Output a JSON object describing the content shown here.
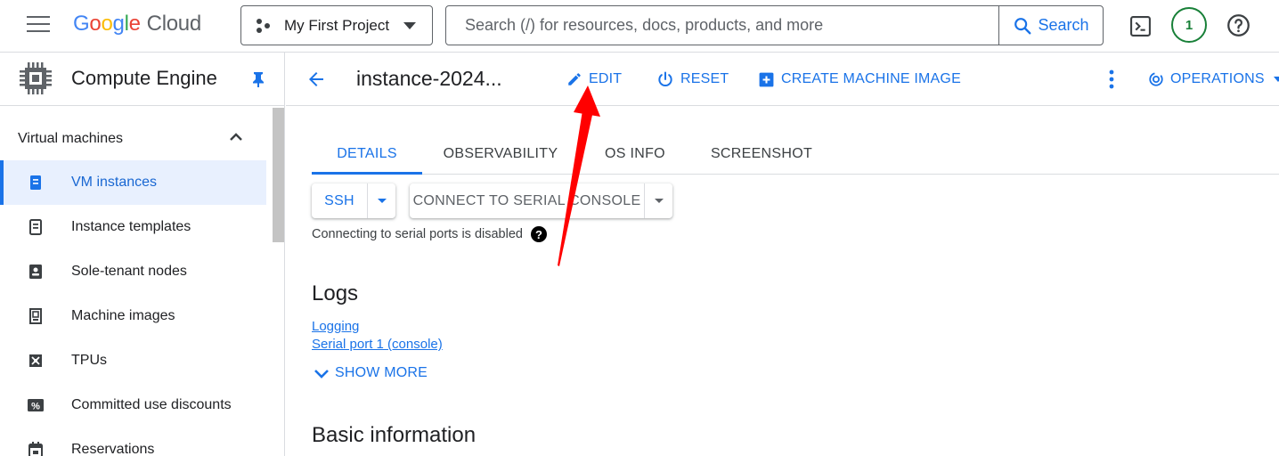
{
  "topbar": {
    "logo_google": [
      "G",
      "o",
      "o",
      "g",
      "l",
      "e"
    ],
    "logo_cloud": "Cloud",
    "project_name": "My First Project",
    "search_placeholder": "Search (/) for resources, docs, products, and more",
    "search_button": "Search",
    "notification_count": "1"
  },
  "sidebar": {
    "product_title": "Compute Engine",
    "section_label": "Virtual machines",
    "items": [
      {
        "label": "VM instances",
        "icon": "vm-instances-icon",
        "active": true
      },
      {
        "label": "Instance templates",
        "icon": "instance-templates-icon"
      },
      {
        "label": "Sole-tenant nodes",
        "icon": "sole-tenant-nodes-icon"
      },
      {
        "label": "Machine images",
        "icon": "machine-images-icon"
      },
      {
        "label": "TPUs",
        "icon": "tpus-icon"
      },
      {
        "label": "Committed use discounts",
        "icon": "committed-use-discounts-icon"
      },
      {
        "label": "Reservations",
        "icon": "reservations-icon"
      }
    ]
  },
  "main": {
    "instance_title": "instance-2024...",
    "actions": {
      "edit": "EDIT",
      "reset": "RESET",
      "create_machine_image": "CREATE MACHINE IMAGE",
      "operations": "OPERATIONS"
    },
    "tabs": [
      {
        "label": "DETAILS",
        "active": true
      },
      {
        "label": "OBSERVABILITY"
      },
      {
        "label": "OS INFO"
      },
      {
        "label": "SCREENSHOT"
      }
    ],
    "ssh_button": "SSH",
    "serial_console_button": "CONNECT TO SERIAL CONSOLE",
    "serial_note": "Connecting to serial ports is disabled",
    "help_glyph": "?",
    "logs_heading": "Logs",
    "logs_links": [
      "Logging",
      "Serial port 1 (console)"
    ],
    "show_more": "SHOW MORE",
    "basic_info_heading": "Basic information"
  },
  "colors": {
    "accent": "#1a73e8",
    "active_nav_bg": "#e8f0fe",
    "annotation_arrow": "#ff0000",
    "notification_ring": "#188038"
  }
}
